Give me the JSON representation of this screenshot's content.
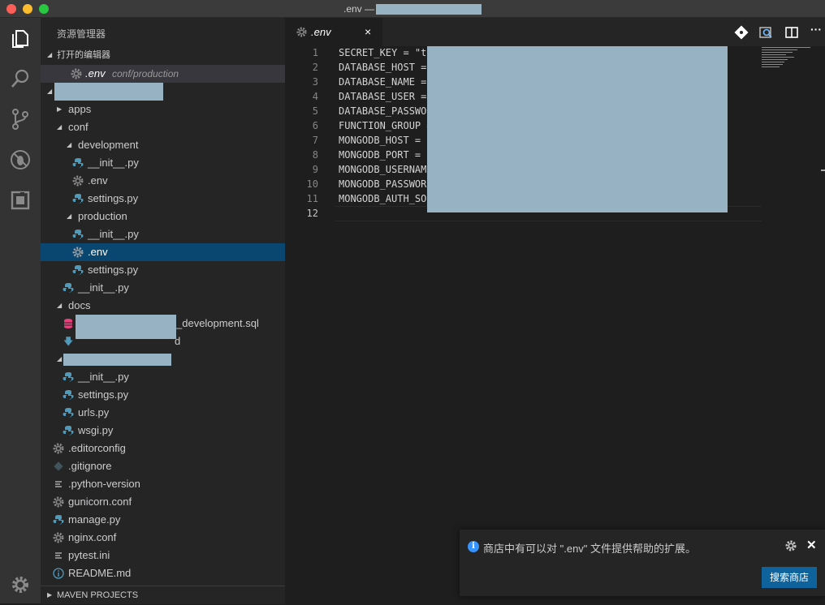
{
  "window": {
    "title_prefix": ".env —"
  },
  "colors": {
    "accent": "#0e639c",
    "selection": "#094771",
    "redaction": "#97b2c2",
    "python_icon": "#519aba"
  },
  "activity": [
    {
      "name": "explorer-icon"
    },
    {
      "name": "search-icon"
    },
    {
      "name": "source-control-icon"
    },
    {
      "name": "debug-icon"
    },
    {
      "name": "extensions-icon"
    },
    {
      "name": "settings-gear-icon"
    }
  ],
  "sidebar": {
    "title": "资源管理器",
    "open_editors": {
      "label": "打开的编辑器",
      "file": ".env",
      "path": "conf/production"
    },
    "tree": {
      "apps": "apps",
      "conf": "conf",
      "development": "development",
      "dev_init": "__init__.py",
      "dev_env": ".env",
      "dev_settings": "settings.py",
      "production": "production",
      "prod_init": "__init__.py",
      "prod_env": ".env",
      "prod_settings": "settings.py",
      "conf_init": "__init__.py",
      "docs": "docs",
      "docs_sql_suffix": "_development.sql",
      "docs_md_suffix": "d",
      "pkg_init": "__init__.py",
      "pkg_settings": "settings.py",
      "pkg_urls": "urls.py",
      "pkg_wsgi": "wsgi.py",
      "editorconfig": ".editorconfig",
      "gitignore": ".gitignore",
      "python_version": ".python-version",
      "gunicorn": "gunicorn.conf",
      "manage": "manage.py",
      "nginx": "nginx.conf",
      "pytest": "pytest.ini",
      "readme": "README.md"
    },
    "maven": "MAVEN PROJECTS"
  },
  "editor": {
    "tab": {
      "label": ".env",
      "close": "×"
    },
    "more": "···",
    "line_numbers": [
      "1",
      "2",
      "3",
      "4",
      "5",
      "6",
      "7",
      "8",
      "9",
      "10",
      "11",
      "12"
    ],
    "lines": [
      "SECRET_KEY = \"t",
      "DATABASE_HOST =",
      "DATABASE_NAME =",
      "DATABASE_USER =",
      "DATABASE_PASSWO",
      "FUNCTION_GROUP =",
      "MONGODB_HOST =",
      "MONGODB_PORT =",
      "MONGODB_USERNAM",
      "MONGODB_PASSWOR",
      "MONGODB_AUTH_SO",
      ""
    ]
  },
  "notification": {
    "message": "商店中有可以对 \".env\" 文件提供帮助的扩展。",
    "button": "搜索商店",
    "close": "✕"
  }
}
